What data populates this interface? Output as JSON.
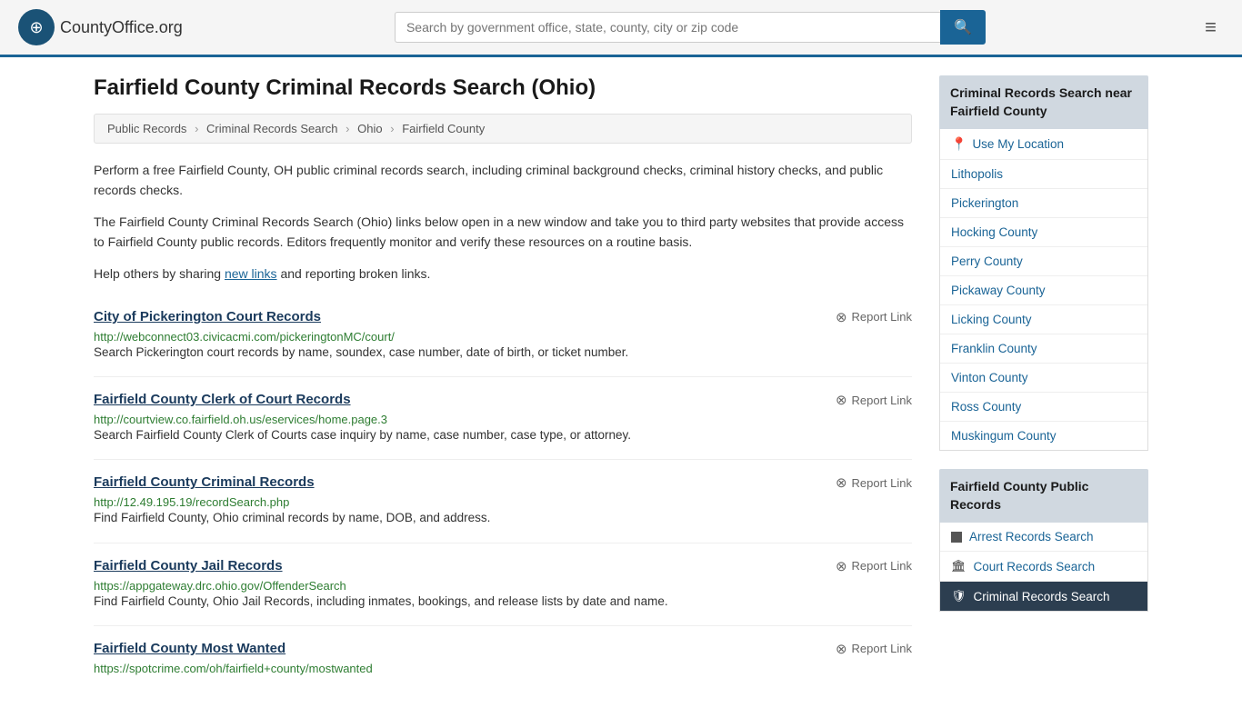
{
  "header": {
    "logo_text": "County",
    "logo_suffix": "Office.org",
    "search_placeholder": "Search by government office, state, county, city or zip code"
  },
  "page": {
    "title": "Fairfield County Criminal Records Search (Ohio)",
    "breadcrumb": [
      {
        "label": "Public Records",
        "url": "#"
      },
      {
        "label": "Criminal Records Search",
        "url": "#"
      },
      {
        "label": "Ohio",
        "url": "#"
      },
      {
        "label": "Fairfield County",
        "url": "#"
      }
    ],
    "description1": "Perform a free Fairfield County, OH public criminal records search, including criminal background checks, criminal history checks, and public records checks.",
    "description2": "The Fairfield County Criminal Records Search (Ohio) links below open in a new window and take you to third party websites that provide access to Fairfield County public records. Editors frequently monitor and verify these resources on a routine basis.",
    "description3_prefix": "Help others by sharing ",
    "description3_link": "new links",
    "description3_suffix": " and reporting broken links."
  },
  "records": [
    {
      "title": "City of Pickerington Court Records",
      "url": "http://webconnect03.civicacmi.com/pickeringtonMC/court/",
      "desc": "Search Pickerington court records by name, soundex, case number, date of birth, or ticket number.",
      "report_label": "Report Link"
    },
    {
      "title": "Fairfield County Clerk of Court Records",
      "url": "http://courtview.co.fairfield.oh.us/eservices/home.page.3",
      "desc": "Search Fairfield County Clerk of Courts case inquiry by name, case number, case type, or attorney.",
      "report_label": "Report Link"
    },
    {
      "title": "Fairfield County Criminal Records",
      "url": "http://12.49.195.19/recordSearch.php",
      "desc": "Find Fairfield County, Ohio criminal records by name, DOB, and address.",
      "report_label": "Report Link"
    },
    {
      "title": "Fairfield County Jail Records",
      "url": "https://appgateway.drc.ohio.gov/OffenderSearch",
      "desc": "Find Fairfield County, Ohio Jail Records, including inmates, bookings, and release lists by date and name.",
      "report_label": "Report Link"
    },
    {
      "title": "Fairfield County Most Wanted",
      "url": "https://spotcrime.com/oh/fairfield+county/mostwanted",
      "desc": "",
      "report_label": "Report Link"
    }
  ],
  "sidebar": {
    "nearby_header": "Criminal Records Search near Fairfield County",
    "use_my_location": "Use My Location",
    "nearby_links": [
      "Lithopolis",
      "Pickerington",
      "Hocking County",
      "Perry County",
      "Pickaway County",
      "Licking County",
      "Franklin County",
      "Vinton County",
      "Ross County",
      "Muskingum County"
    ],
    "public_records_header": "Fairfield County Public Records",
    "public_records": [
      {
        "label": "Arrest Records Search",
        "icon": "square",
        "active": false
      },
      {
        "label": "Court Records Search",
        "icon": "building",
        "active": false
      },
      {
        "label": "Criminal Records Search",
        "icon": "shield",
        "active": true
      }
    ]
  }
}
